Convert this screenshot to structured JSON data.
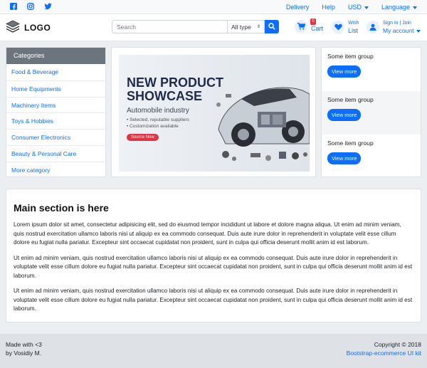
{
  "topbar": {
    "social": [
      "facebook-icon",
      "instagram-icon",
      "twitter-icon"
    ],
    "links": {
      "delivery": "Delivery",
      "help": "Help",
      "currency": "USD",
      "language": "Language"
    }
  },
  "header": {
    "logo_text": "LOGO",
    "search": {
      "placeholder": "Search",
      "category": "All type"
    },
    "cart": {
      "label": "Cart",
      "count": "0"
    },
    "wishlist": {
      "line1": "Wish",
      "line2": "List"
    },
    "account": {
      "line1": "Sign in | Join",
      "line2": "My account"
    }
  },
  "categories": {
    "title": "Categories",
    "items": [
      "Food & Beverage",
      "Home Equipments",
      "Machinery Items",
      "Toys & Hobbies",
      "Consumer Electronics",
      "Beauty & Personal Care",
      "More category"
    ]
  },
  "banner": {
    "title_line1": "NEW PRODUCT",
    "title_line2": "SHOWCASE",
    "subtitle": "Automobile industry",
    "bullet1": "• Selected, reputable suppliers",
    "bullet2": "• Customization available",
    "button": "Source Now"
  },
  "item_groups": [
    {
      "title": "Some item group",
      "button": "View more"
    },
    {
      "title": "Some item group",
      "button": "View more"
    },
    {
      "title": "Some item group",
      "button": "View more"
    }
  ],
  "main": {
    "heading": "Main section is here",
    "paragraphs": [
      "Lorem ipsum dolor sit amet, consectetur adipisicing elit, sed do eiusmod tempor incididunt ut labore et dolore magna aliqua. Ut enim ad minim veniam, quis nostrud exercitation ullamco laboris nisi ut aliquip ex ea commodo consequat. Duis aute irure dolor in reprehenderit in voluptate velit esse cillum dolore eu fugiat nulla pariatur. Excepteur sint occaecat cupidatat non proident, sunt in culpa qui officia deserunt mollit anim id est laborum.",
      "Ut enim ad minim veniam, quis nostrud exercitation ullamco laboris nisi ut aliquip ex ea commodo consequat. Duis aute irure dolor in reprehenderit in voluptate velit esse cillum dolore eu fugiat nulla pariatur. Excepteur sint occaecat cupidatat non proident, sunt in culpa qui officia deserunt mollit anim id est laborum.",
      "Ut enim ad minim veniam, quis nostrud exercitation ullamco laboris nisi ut aliquip ex ea commodo consequat. Duis aute irure dolor in reprehenderit in voluptate velit esse cillum dolore eu fugiat nulla pariatur. Excepteur sint occaecat cupidatat non proident, sunt in culpa qui officia deserunt mollit anim id est laborum."
    ]
  },
  "footer": {
    "left_line1": "Made with <3",
    "left_line2": "by Vosidiy M.",
    "copyright": "Copyright © 2018",
    "kit_link": "Bootstrap-ecommerce UI kit"
  },
  "colors": {
    "accent": "#0d6efd",
    "header_gray": "#6c757d",
    "badge_red": "#dc3545"
  }
}
